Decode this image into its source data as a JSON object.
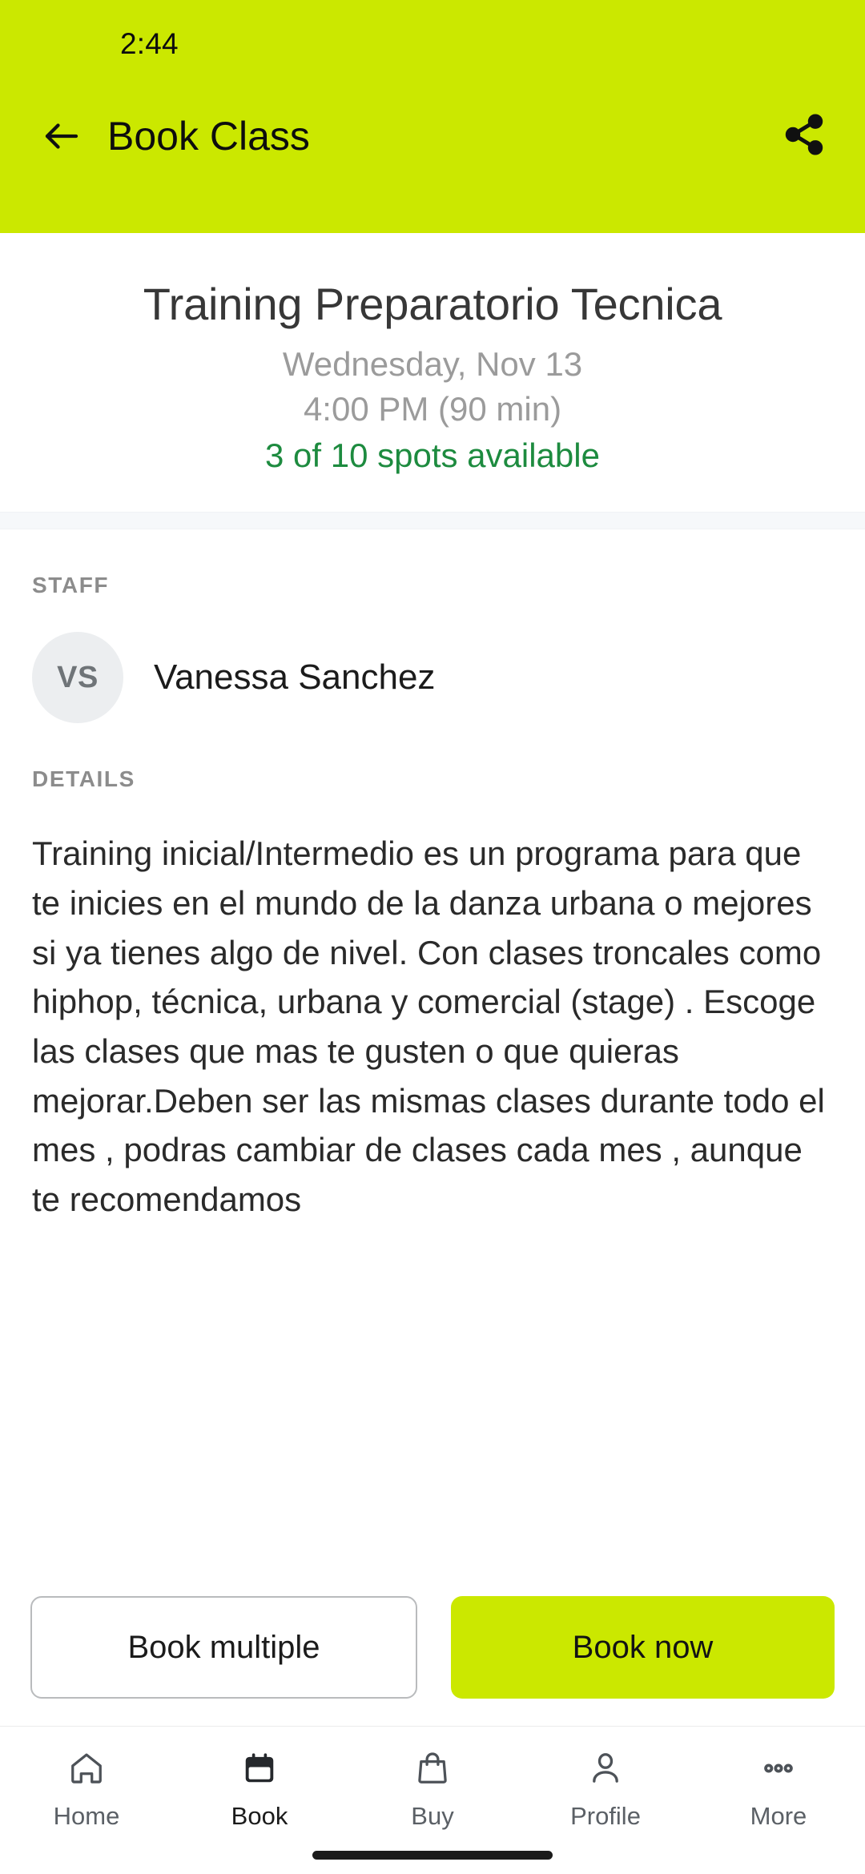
{
  "status_bar": {
    "time": "2:44"
  },
  "app_bar": {
    "title": "Book Class",
    "back_icon": "arrow-left-icon",
    "share_icon": "share-icon",
    "background_color": "#cbe800"
  },
  "class": {
    "title": "Training Preparatorio Tecnica",
    "date": "Wednesday, Nov 13",
    "time": "4:00 PM (90 min)",
    "spots": "3 of 10 spots available",
    "spots_color": "#1d8b3f",
    "spots_open": 3,
    "spots_total": 10
  },
  "staff": {
    "label": "STAFF",
    "initials": "VS",
    "name": "Vanessa Sanchez"
  },
  "details": {
    "label": "DETAILS",
    "text": "Training inicial/Intermedio es un programa para que te inicies en el mundo de la danza urbana o mejores si ya tienes algo de nivel. Con clases troncales como hiphop, técnica, urbana y comercial (stage) . Escoge las clases que mas te gusten o que quieras mejorar.Deben ser las mismas clases durante todo el mes , podras cambiar de clases cada mes , aunque te recomendamos"
  },
  "actions": {
    "secondary_label": "Book multiple",
    "primary_label": "Book now",
    "primary_color": "#cbe800"
  },
  "bottom_nav": {
    "items": [
      {
        "label": "Home",
        "icon": "home-icon",
        "active": false
      },
      {
        "label": "Book",
        "icon": "calendar-icon",
        "active": true
      },
      {
        "label": "Buy",
        "icon": "bag-icon",
        "active": false
      },
      {
        "label": "Profile",
        "icon": "person-icon",
        "active": false
      },
      {
        "label": "More",
        "icon": "ellipsis-icon",
        "active": false
      }
    ]
  }
}
